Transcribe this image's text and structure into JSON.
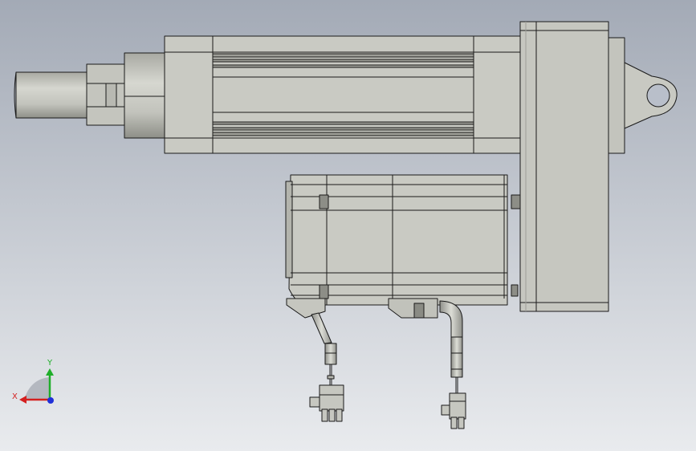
{
  "viewport": {
    "background_top": "#a3aab6",
    "background_bottom": "#e9ebee",
    "model": {
      "body_fill": "#c8c9c1",
      "body_light": "#d8d9d2",
      "body_dark": "#9d9e97",
      "edge": "#1a1a1a"
    }
  },
  "triad": {
    "x_label": "X",
    "y_label": "Y",
    "x_color": "#d42020",
    "y_color": "#1fae2a",
    "z_color": "#2030d8"
  }
}
